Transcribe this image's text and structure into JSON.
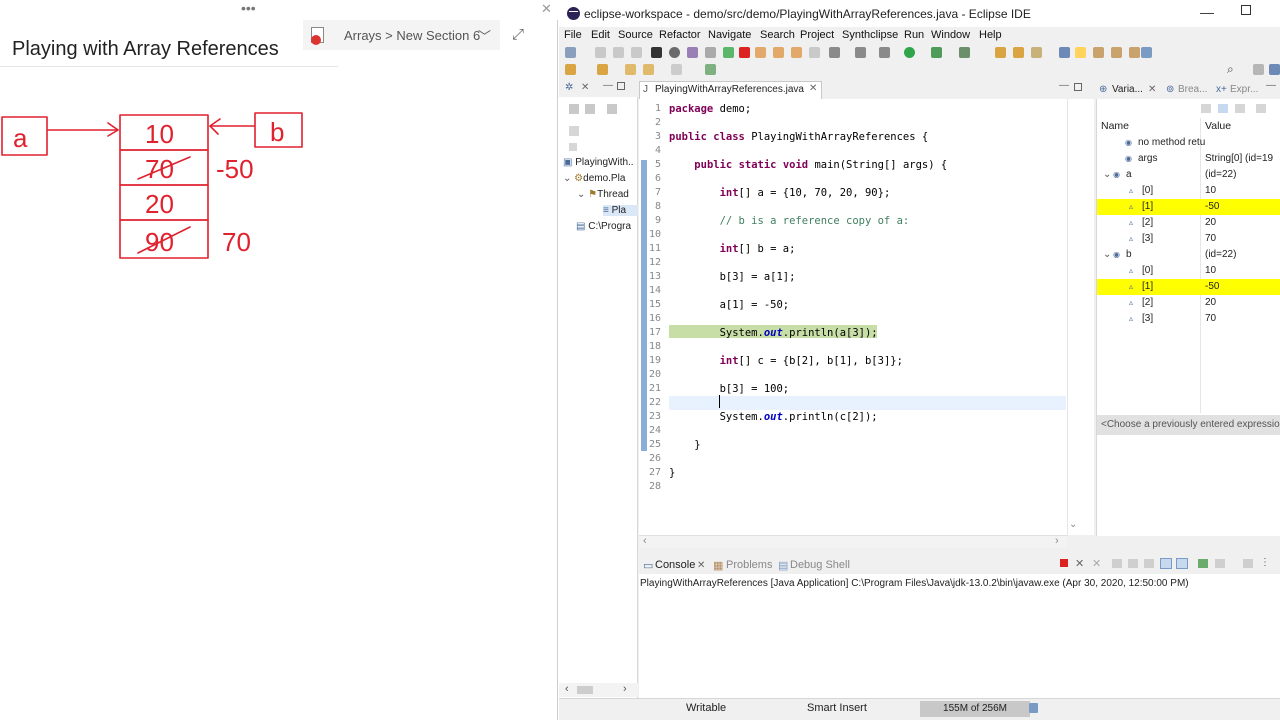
{
  "onenote": {
    "page_title": "Playing with Array References",
    "section_path": "Arrays > New Section 6",
    "drawing": {
      "a_label": "a",
      "b_label": "b",
      "cells": [
        "10",
        "70",
        "20",
        "90"
      ],
      "annotation_1": "-50",
      "annotation_3": "70"
    }
  },
  "eclipse": {
    "window_title": "eclipse-workspace - demo/src/demo/PlayingWithArrayReferences.java - Eclipse IDE",
    "menu": [
      "File",
      "Edit",
      "Source",
      "Refactor",
      "Navigate",
      "Search",
      "Project",
      "Synthclipse",
      "Run",
      "Window",
      "Help"
    ],
    "package_explorer": {
      "items": [
        "PlayingWith..",
        "demo.Pla",
        "Thread",
        "Pla",
        "C:\\Progra"
      ]
    },
    "editor": {
      "tab_label": "PlayingWithArrayReferences.java",
      "line_numbers": [
        "1",
        "2",
        "3",
        "4",
        "5",
        "6",
        "7",
        "8",
        "9",
        "10",
        "11",
        "12",
        "13",
        "14",
        "15",
        "16",
        "17",
        "18",
        "19",
        "20",
        "21",
        "22",
        "23",
        "24",
        "25",
        "26",
        "27",
        "28"
      ],
      "lines": [
        "package demo;",
        "",
        "public class PlayingWithArrayReferences {",
        "",
        "    public static void main(String[] args) {",
        "",
        "        int[] a = {10, 70, 20, 90};",
        "",
        "        // b is a reference copy of a:",
        "",
        "        int[] b = a;",
        "",
        "        b[3] = a[1];",
        "",
        "        a[1] = -50;",
        "",
        "        System.out.println(a[3]);",
        "",
        "        int[] c = {b[2], b[1], b[3]};",
        "",
        "        b[3] = 100;",
        "",
        "        System.out.println(c[2]);",
        "",
        "    }",
        "",
        "}",
        ""
      ]
    },
    "variables": {
      "tabs": [
        "Varia...",
        "Brea...",
        "Expr..."
      ],
      "columns": [
        "Name",
        "Value"
      ],
      "rows": [
        {
          "name": "no method retu",
          "value": "",
          "highlight": false,
          "indent": 0
        },
        {
          "name": "args",
          "value": "String[0]  (id=19",
          "highlight": false,
          "indent": 0
        },
        {
          "name": "a",
          "value": "(id=22)",
          "highlight": false,
          "indent": 0
        },
        {
          "name": "[0]",
          "value": "10",
          "highlight": false,
          "indent": 1
        },
        {
          "name": "[1]",
          "value": "-50",
          "highlight": true,
          "indent": 1
        },
        {
          "name": "[2]",
          "value": "20",
          "highlight": false,
          "indent": 1
        },
        {
          "name": "[3]",
          "value": "70",
          "highlight": false,
          "indent": 1
        },
        {
          "name": "b",
          "value": "(id=22)",
          "highlight": false,
          "indent": 0
        },
        {
          "name": "[0]",
          "value": "10",
          "highlight": false,
          "indent": 1
        },
        {
          "name": "[1]",
          "value": "-50",
          "highlight": true,
          "indent": 1
        },
        {
          "name": "[2]",
          "value": "20",
          "highlight": false,
          "indent": 1
        },
        {
          "name": "[3]",
          "value": "70",
          "highlight": false,
          "indent": 1
        }
      ],
      "expression_placeholder": "<Choose a previously entered expressio"
    },
    "console": {
      "tabs": [
        "Console",
        "Problems",
        "Debug Shell"
      ],
      "output": "PlayingWithArrayReferences [Java Application] C:\\Program Files\\Java\\jdk-13.0.2\\bin\\javaw.exe  (Apr 30, 2020, 12:50:00 PM)"
    },
    "status": {
      "writable": "Writable",
      "insert_mode": "Smart Insert",
      "heap": "155M of 256M"
    }
  }
}
